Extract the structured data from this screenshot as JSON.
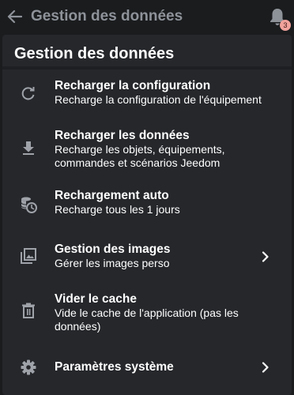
{
  "appbar": {
    "title": "Gestion des données",
    "notification_count": "3"
  },
  "panel": {
    "title": "Gestion des données"
  },
  "items": [
    {
      "icon": "refresh-icon",
      "title": "Recharger la configuration",
      "subtitle": "Recharge la configuration de l'équipement"
    },
    {
      "icon": "download-icon",
      "title": "Recharger les données",
      "subtitle": "Recharge les objets, équipements, commandes et scénarios Jeedom"
    },
    {
      "icon": "database-clock-icon",
      "title": "Rechargement auto",
      "subtitle": "Recharge tous les 1 jours"
    },
    {
      "icon": "image-multiple-icon",
      "title": "Gestion des images",
      "subtitle": "Gérer les images perso"
    },
    {
      "icon": "trash-icon",
      "title": "Vider le cache",
      "subtitle": "Vide le cache de l'application (pas les données)"
    },
    {
      "icon": "gear-icon",
      "title": "Paramètres système",
      "subtitle": ""
    }
  ],
  "colors": {
    "background": "#1a1c1e",
    "panel": "#25272b",
    "appbar_text": "#8e9299",
    "icon": "#9fa3a9",
    "badge": "#f1a29b"
  }
}
